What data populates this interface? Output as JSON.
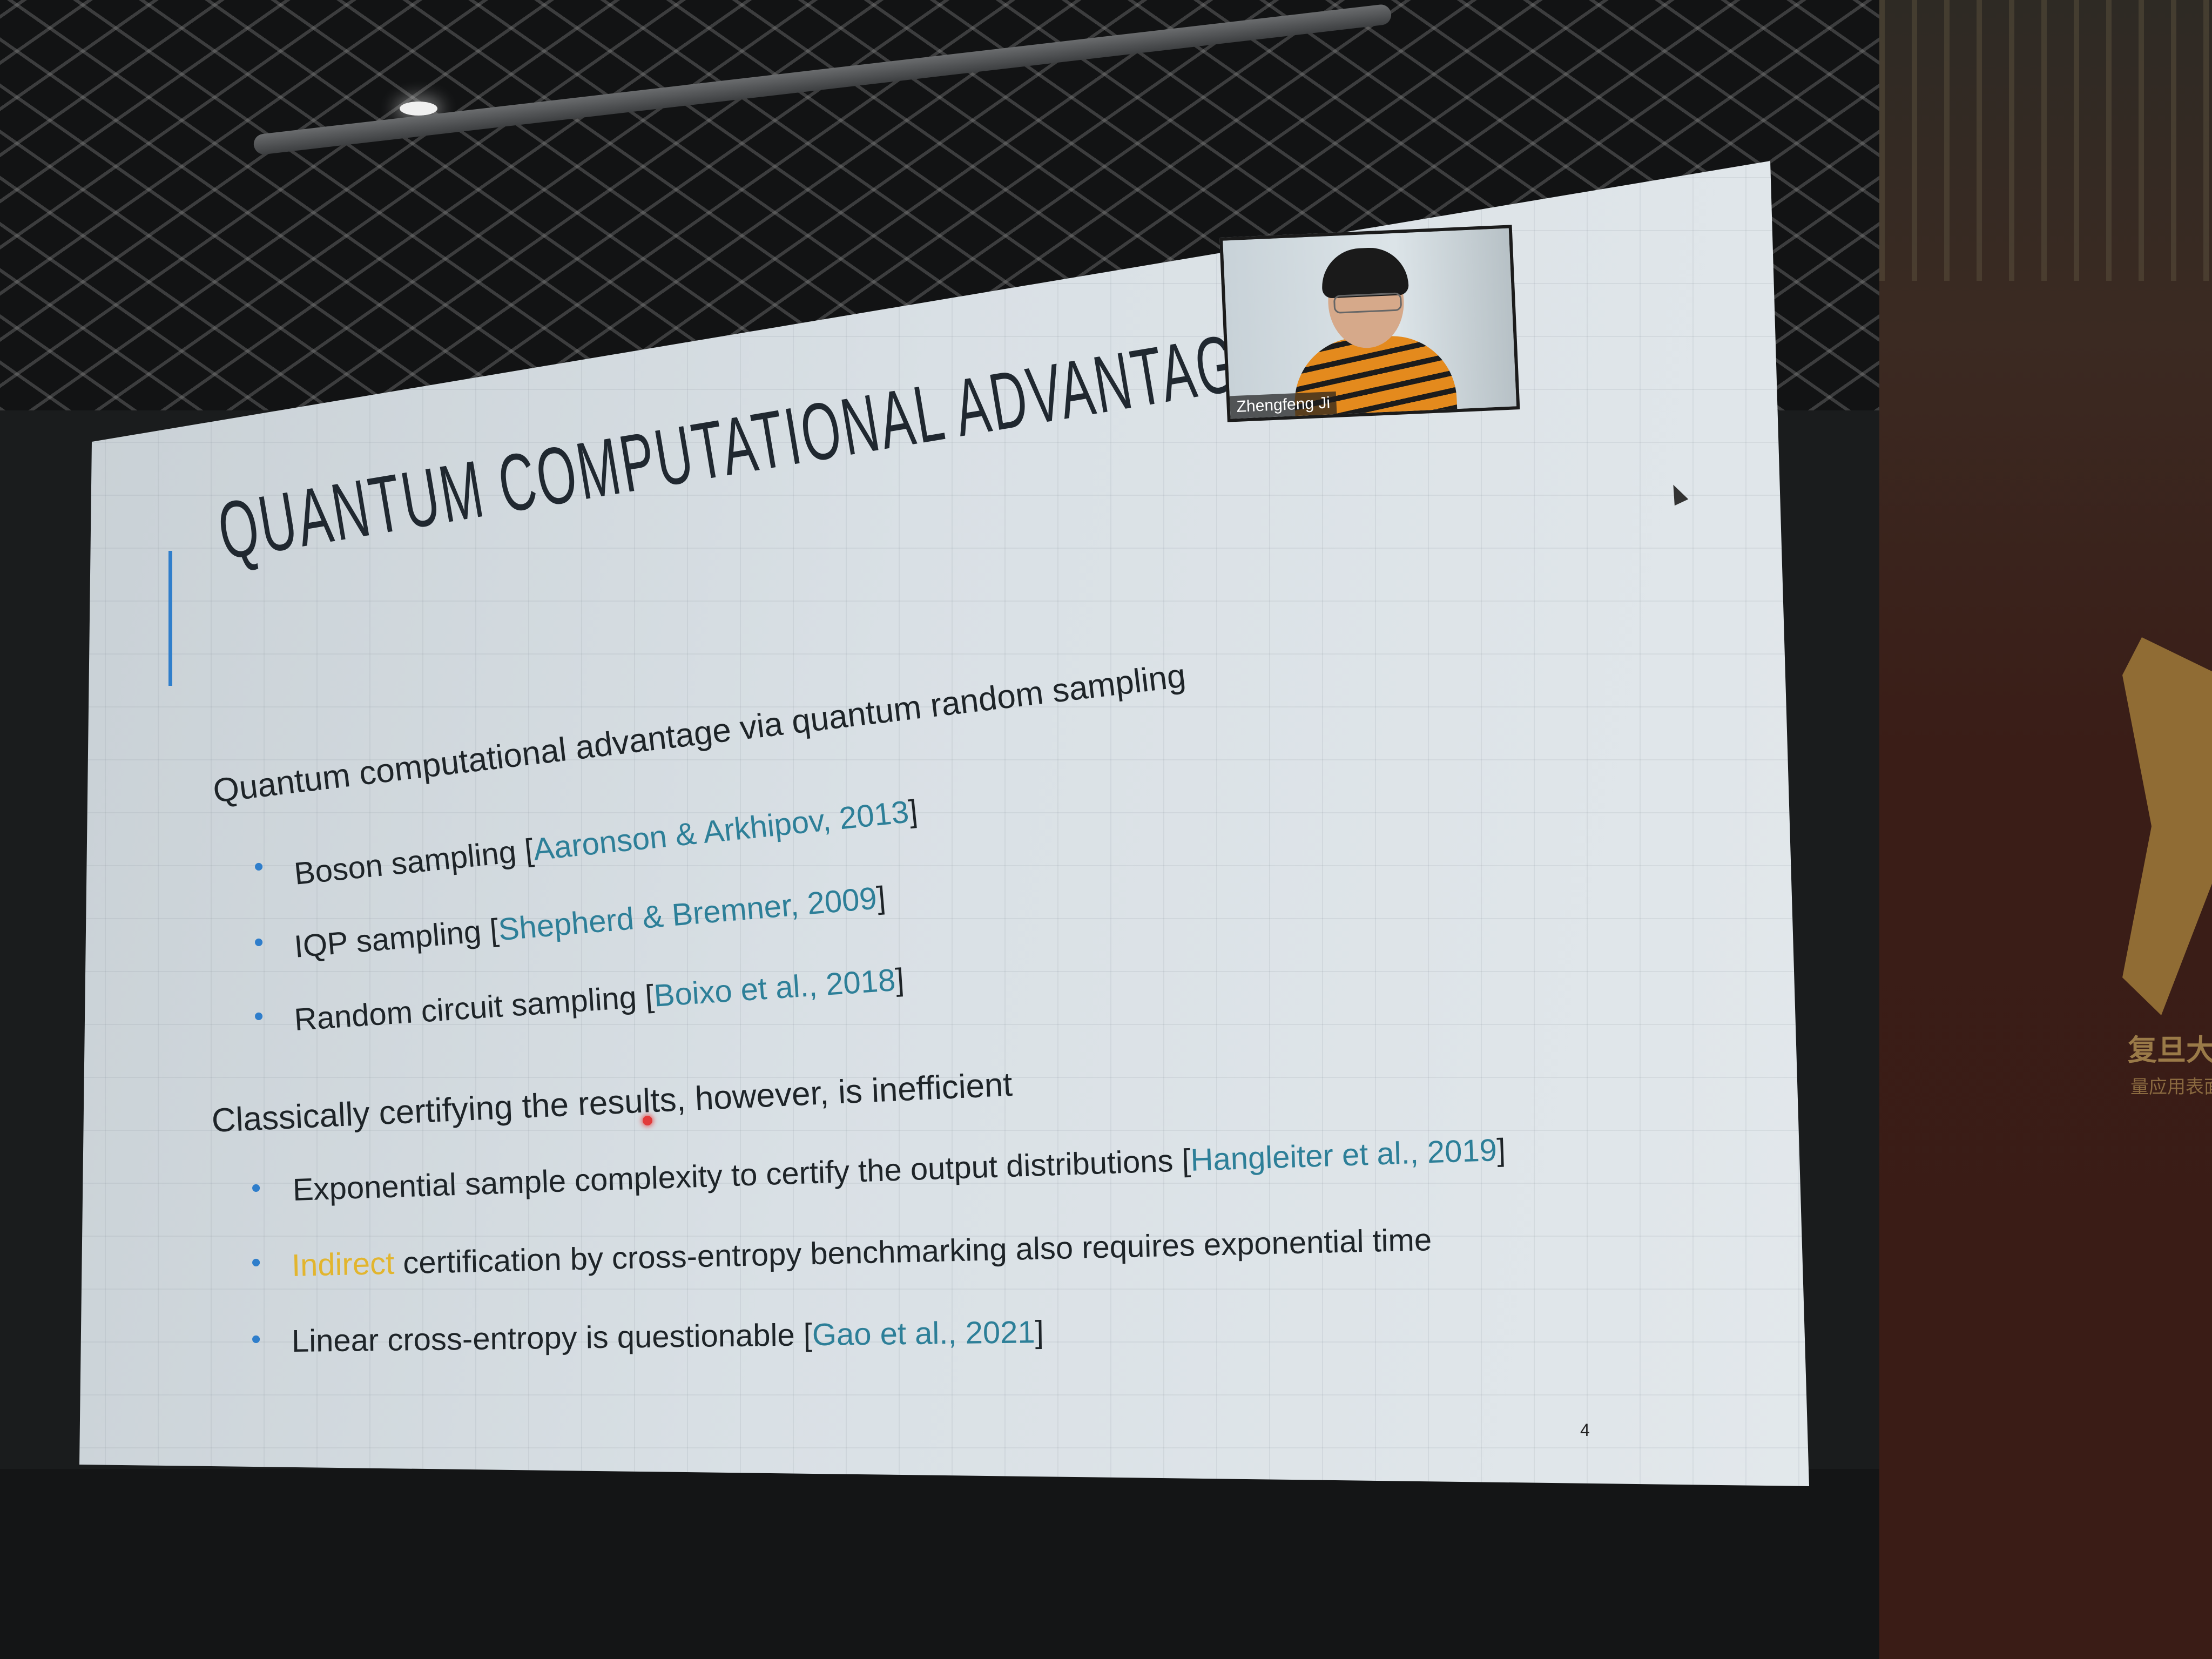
{
  "slide": {
    "title": "QUANTUM COMPUTATIONAL ADVANTAGE",
    "section1": {
      "heading": "Quantum computational advantage via quantum random sampling",
      "items": [
        {
          "text": "Boson sampling [",
          "ref": "Aaronson & Arkhipov, 2013",
          "close": "]"
        },
        {
          "text": "IQP sampling [",
          "ref": "Shepherd & Bremner, 2009",
          "close": "]"
        },
        {
          "text": "Random circuit sampling [",
          "ref": "Boixo et al., 2018",
          "close": "]"
        }
      ]
    },
    "section2": {
      "heading": "Classically certifying the results, however, is inefficient",
      "items": [
        {
          "text": "Exponential sample complexity to certify the output distributions [",
          "ref": "Hangleiter et al., 2019",
          "close": "]"
        },
        {
          "highlight": "Indirect",
          "text": " certification by cross-entropy benchmarking also requires exponential time"
        },
        {
          "text": "Linear cross-entropy is questionable [",
          "ref": "Gao et al., 2021",
          "close": "]"
        }
      ]
    },
    "page_number": "4"
  },
  "video": {
    "participant_name": "Zhengfeng Ji"
  },
  "background": {
    "wall_text": "复旦大学",
    "wall_subtext": "量应用表面"
  },
  "colors": {
    "accent": "#2f7ecb",
    "reference": "#2d7f98",
    "highlight": "#e2b52e"
  },
  "icons": {
    "cursor": "mouse-pointer-icon",
    "laser": "laser-pointer-dot"
  }
}
